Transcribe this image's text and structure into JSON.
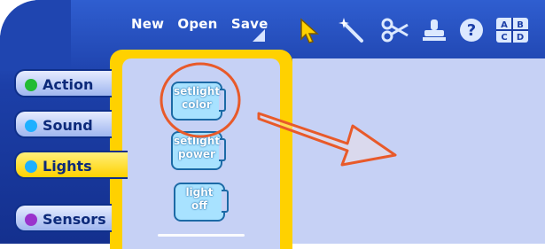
{
  "menu": {
    "new": "New",
    "open": "Open",
    "save": "Save"
  },
  "tabs": [
    {
      "label": "Action",
      "dot_color": "#22bb33"
    },
    {
      "label": "Sound",
      "dot_color": "#1fb0ff"
    },
    {
      "label": "Lights",
      "dot_color": "#1fb0ff",
      "active": true
    },
    {
      "label": "Sensors",
      "dot_color": "#9a33cc"
    }
  ],
  "palette": {
    "blocks": [
      {
        "line1": "setlight",
        "line2": "color",
        "highlighted": true
      },
      {
        "line1": "setlight",
        "line2": "power"
      },
      {
        "line1": "light",
        "line2": "off"
      }
    ]
  },
  "toolbar_icons": [
    "pointer-arrow-icon",
    "magic-wand-icon",
    "scissors-icon",
    "stamp-icon",
    "help-icon",
    "abcd-grid-icon"
  ],
  "toolbar": {
    "help_glyph": "?",
    "grid_letters": [
      "A",
      "B",
      "C",
      "D"
    ]
  },
  "colors": {
    "frame": "#1c3fa8",
    "palette_border": "#ffd100",
    "canvas": "#c6d1f5",
    "annotation": "#e85a2a"
  }
}
